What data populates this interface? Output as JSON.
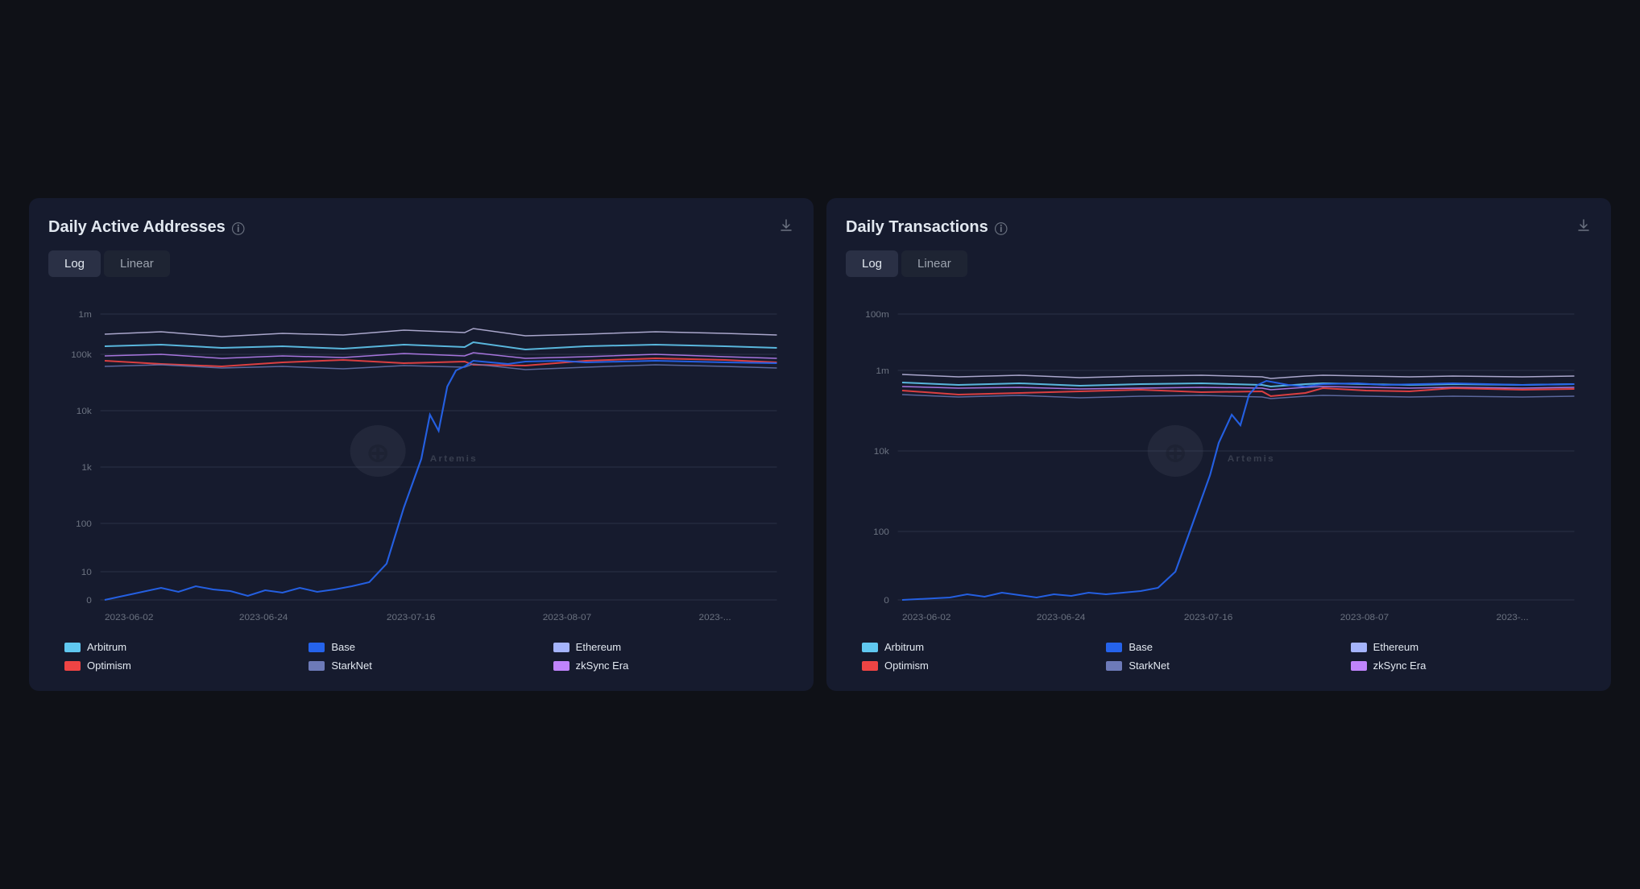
{
  "cards": [
    {
      "id": "daily-active-addresses",
      "title": "Daily Active Addresses",
      "download_icon": "⬇",
      "info_icon": "ⓘ",
      "toggle": {
        "options": [
          "Log",
          "Linear"
        ],
        "active": "Log"
      },
      "y_labels": [
        "1m",
        "100k",
        "10k",
        "1k",
        "100",
        "10",
        "0"
      ],
      "x_labels": [
        "2023-06-02",
        "2023-06-24",
        "2023-07-16",
        "2023-08-07",
        "2023-..."
      ],
      "legend": [
        {
          "label": "Arbitrum",
          "color": "#60c8f0"
        },
        {
          "label": "Base",
          "color": "#2563eb"
        },
        {
          "label": "Ethereum",
          "color": "#a5b4fc"
        },
        {
          "label": "Optimism",
          "color": "#ef4444"
        },
        {
          "label": "StarkNet",
          "color": "#6d7ab8"
        },
        {
          "label": "zkSync Era",
          "color": "#c084fc"
        }
      ]
    },
    {
      "id": "daily-transactions",
      "title": "Daily Transactions",
      "download_icon": "⬇",
      "info_icon": "ⓘ",
      "toggle": {
        "options": [
          "Log",
          "Linear"
        ],
        "active": "Log"
      },
      "y_labels": [
        "100m",
        "1m",
        "10k",
        "100",
        "0"
      ],
      "x_labels": [
        "2023-06-02",
        "2023-06-24",
        "2023-07-16",
        "2023-08-07",
        "2023-..."
      ],
      "legend": [
        {
          "label": "Arbitrum",
          "color": "#60c8f0"
        },
        {
          "label": "Base",
          "color": "#2563eb"
        },
        {
          "label": "Ethereum",
          "color": "#a5b4fc"
        },
        {
          "label": "Optimism",
          "color": "#ef4444"
        },
        {
          "label": "StarkNet",
          "color": "#6d7ab8"
        },
        {
          "label": "zkSync Era",
          "color": "#c084fc"
        }
      ]
    }
  ]
}
